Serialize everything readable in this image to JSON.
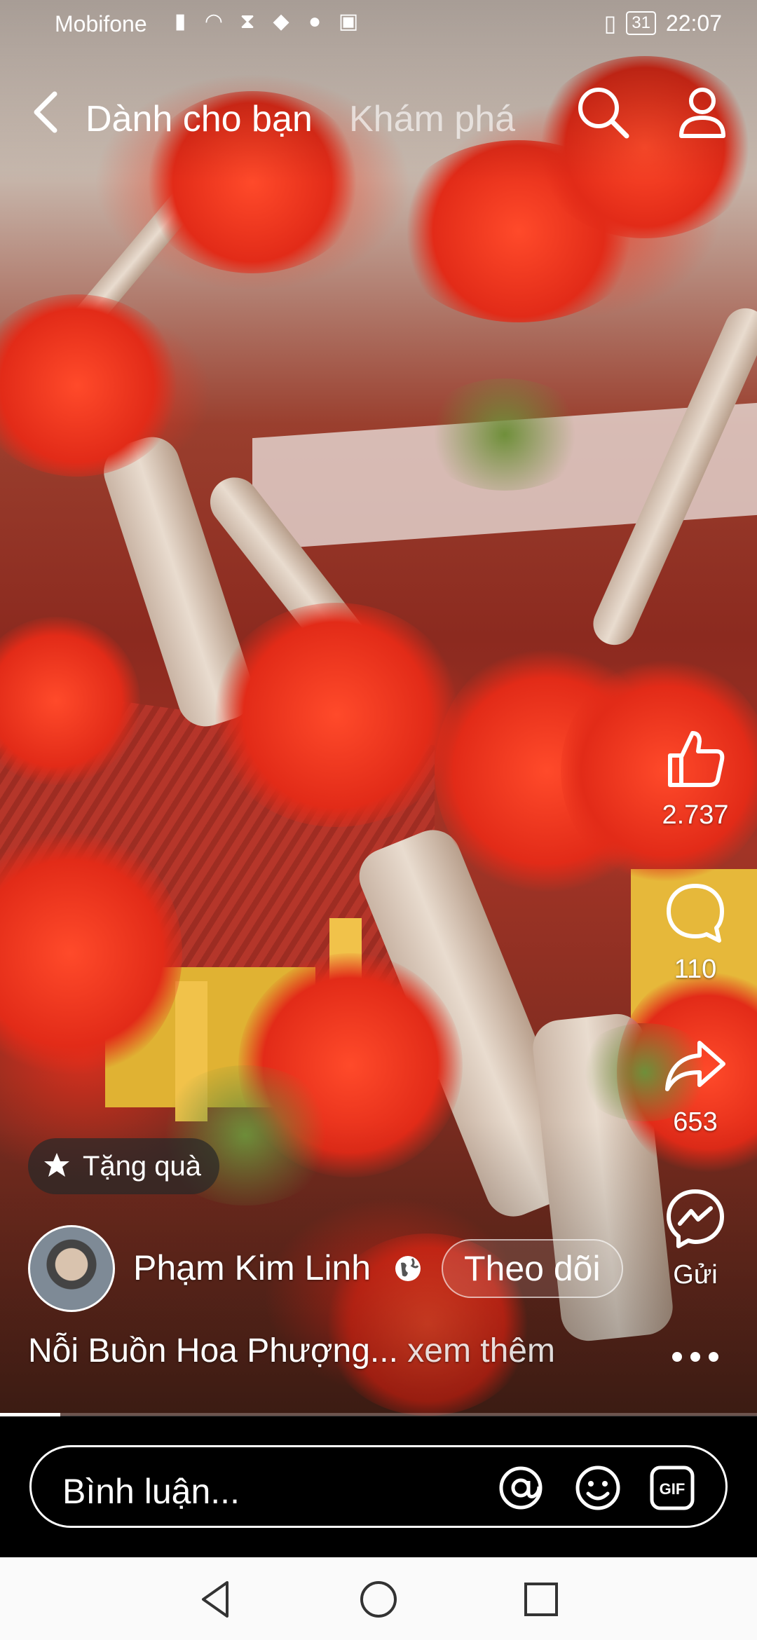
{
  "status_bar": {
    "carrier": "Mobifone",
    "battery": "31",
    "time": "22:07"
  },
  "header": {
    "tabs": [
      {
        "label": "Dành cho bạn",
        "active": true
      },
      {
        "label": "Khám phá",
        "active": false
      }
    ]
  },
  "actions": {
    "like_count": "2.737",
    "comment_count": "110",
    "share_count": "653",
    "send_label": "Gửi"
  },
  "post": {
    "gift_label": "Tặng quà",
    "author": "Phạm Kim Linh",
    "follow_label": "Theo dõi",
    "caption": "Nỗi Buồn Hoa Phượng...",
    "see_more": "xem thêm",
    "progress": 0.08
  },
  "comment_bar": {
    "placeholder": "Bình luận..."
  },
  "icons": [
    "back-icon",
    "search-icon",
    "profile-icon",
    "like-icon",
    "comment-icon",
    "share-icon",
    "messenger-icon",
    "gift-icon",
    "globe-icon",
    "more-icon",
    "mention-icon",
    "emoji-icon",
    "gif-icon"
  ]
}
